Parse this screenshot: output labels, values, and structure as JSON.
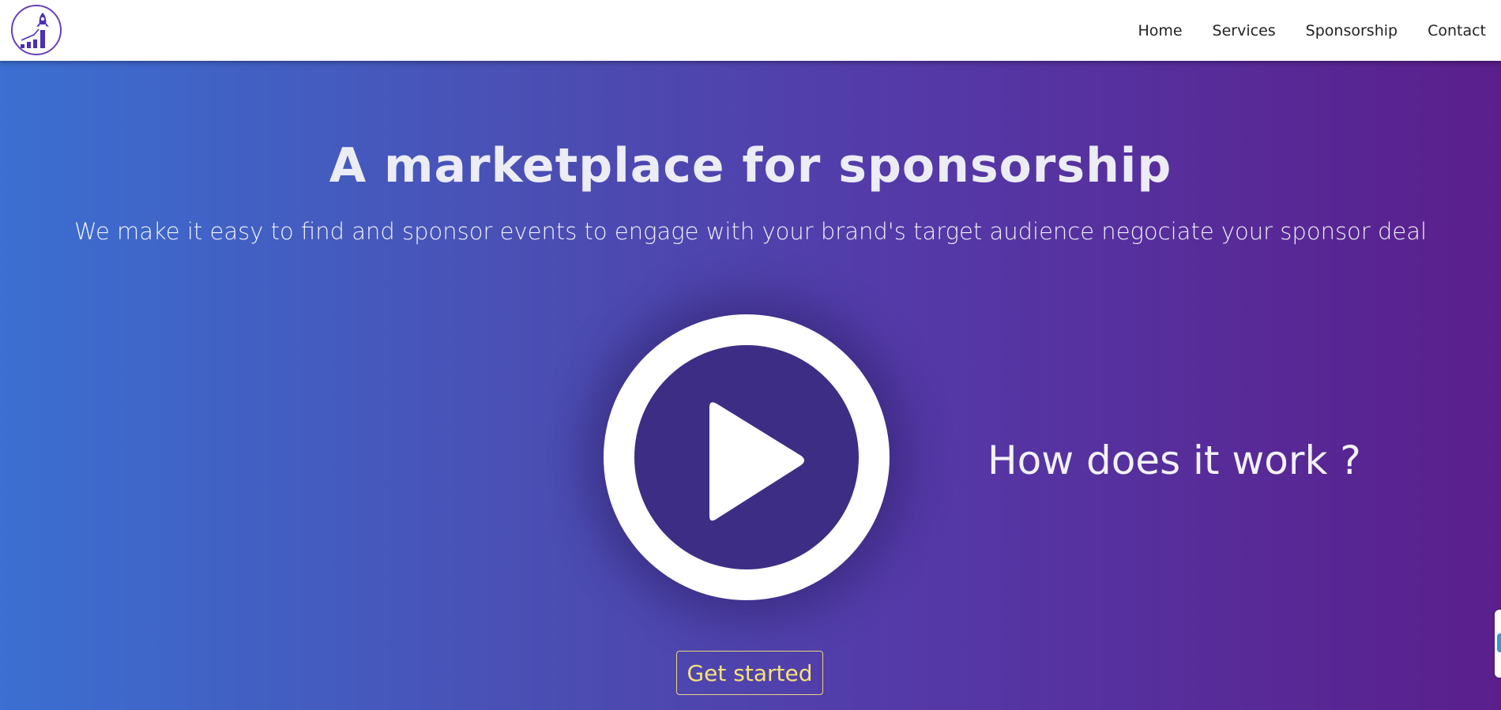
{
  "header": {
    "logo_icon": "rocket-growth-chart-logo",
    "nav": [
      {
        "label": "Home"
      },
      {
        "label": "Services"
      },
      {
        "label": "Sponsorship"
      },
      {
        "label": "Contact"
      }
    ]
  },
  "hero": {
    "title": "A marketplace for sponsorship",
    "subtitle": "We make it easy to find and sponsor events to engage with your brand's target audience negociate your sponsor deal",
    "play_icon": "play-circle-icon",
    "how_label": "How does it work ?",
    "cta_label": "Get started"
  },
  "colors": {
    "gradient_start": "#3b6fd1",
    "gradient_end": "#5a1f8c",
    "logo_accent": "#4a2fb8",
    "cta_text": "#f5e37a",
    "side_tab_accent": "#2a9bd8"
  }
}
